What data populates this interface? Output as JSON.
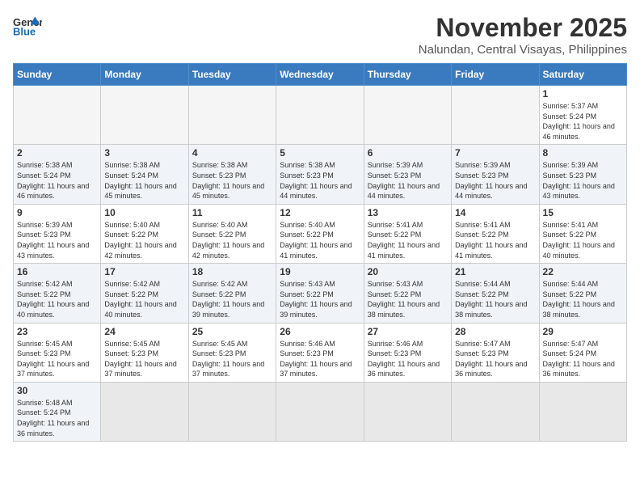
{
  "header": {
    "logo_general": "General",
    "logo_blue": "Blue",
    "month_title": "November 2025",
    "location": "Nalundan, Central Visayas, Philippines"
  },
  "days_of_week": [
    "Sunday",
    "Monday",
    "Tuesday",
    "Wednesday",
    "Thursday",
    "Friday",
    "Saturday"
  ],
  "weeks": [
    {
      "alt": false,
      "days": [
        {
          "number": "",
          "empty": true
        },
        {
          "number": "",
          "empty": true
        },
        {
          "number": "",
          "empty": true
        },
        {
          "number": "",
          "empty": true
        },
        {
          "number": "",
          "empty": true
        },
        {
          "number": "",
          "empty": true
        },
        {
          "number": "1",
          "sunrise": "5:37 AM",
          "sunset": "5:24 PM",
          "daylight": "11 hours and 46 minutes."
        }
      ]
    },
    {
      "alt": true,
      "days": [
        {
          "number": "2",
          "sunrise": "5:38 AM",
          "sunset": "5:24 PM",
          "daylight": "11 hours and 46 minutes."
        },
        {
          "number": "3",
          "sunrise": "5:38 AM",
          "sunset": "5:24 PM",
          "daylight": "11 hours and 45 minutes."
        },
        {
          "number": "4",
          "sunrise": "5:38 AM",
          "sunset": "5:23 PM",
          "daylight": "11 hours and 45 minutes."
        },
        {
          "number": "5",
          "sunrise": "5:38 AM",
          "sunset": "5:23 PM",
          "daylight": "11 hours and 44 minutes."
        },
        {
          "number": "6",
          "sunrise": "5:39 AM",
          "sunset": "5:23 PM",
          "daylight": "11 hours and 44 minutes."
        },
        {
          "number": "7",
          "sunrise": "5:39 AM",
          "sunset": "5:23 PM",
          "daylight": "11 hours and 44 minutes."
        },
        {
          "number": "8",
          "sunrise": "5:39 AM",
          "sunset": "5:23 PM",
          "daylight": "11 hours and 43 minutes."
        }
      ]
    },
    {
      "alt": false,
      "days": [
        {
          "number": "9",
          "sunrise": "5:39 AM",
          "sunset": "5:23 PM",
          "daylight": "11 hours and 43 minutes."
        },
        {
          "number": "10",
          "sunrise": "5:40 AM",
          "sunset": "5:22 PM",
          "daylight": "11 hours and 42 minutes."
        },
        {
          "number": "11",
          "sunrise": "5:40 AM",
          "sunset": "5:22 PM",
          "daylight": "11 hours and 42 minutes."
        },
        {
          "number": "12",
          "sunrise": "5:40 AM",
          "sunset": "5:22 PM",
          "daylight": "11 hours and 41 minutes."
        },
        {
          "number": "13",
          "sunrise": "5:41 AM",
          "sunset": "5:22 PM",
          "daylight": "11 hours and 41 minutes."
        },
        {
          "number": "14",
          "sunrise": "5:41 AM",
          "sunset": "5:22 PM",
          "daylight": "11 hours and 41 minutes."
        },
        {
          "number": "15",
          "sunrise": "5:41 AM",
          "sunset": "5:22 PM",
          "daylight": "11 hours and 40 minutes."
        }
      ]
    },
    {
      "alt": true,
      "days": [
        {
          "number": "16",
          "sunrise": "5:42 AM",
          "sunset": "5:22 PM",
          "daylight": "11 hours and 40 minutes."
        },
        {
          "number": "17",
          "sunrise": "5:42 AM",
          "sunset": "5:22 PM",
          "daylight": "11 hours and 40 minutes."
        },
        {
          "number": "18",
          "sunrise": "5:42 AM",
          "sunset": "5:22 PM",
          "daylight": "11 hours and 39 minutes."
        },
        {
          "number": "19",
          "sunrise": "5:43 AM",
          "sunset": "5:22 PM",
          "daylight": "11 hours and 39 minutes."
        },
        {
          "number": "20",
          "sunrise": "5:43 AM",
          "sunset": "5:22 PM",
          "daylight": "11 hours and 38 minutes."
        },
        {
          "number": "21",
          "sunrise": "5:44 AM",
          "sunset": "5:22 PM",
          "daylight": "11 hours and 38 minutes."
        },
        {
          "number": "22",
          "sunrise": "5:44 AM",
          "sunset": "5:22 PM",
          "daylight": "11 hours and 38 minutes."
        }
      ]
    },
    {
      "alt": false,
      "days": [
        {
          "number": "23",
          "sunrise": "5:45 AM",
          "sunset": "5:23 PM",
          "daylight": "11 hours and 37 minutes."
        },
        {
          "number": "24",
          "sunrise": "5:45 AM",
          "sunset": "5:23 PM",
          "daylight": "11 hours and 37 minutes."
        },
        {
          "number": "25",
          "sunrise": "5:45 AM",
          "sunset": "5:23 PM",
          "daylight": "11 hours and 37 minutes."
        },
        {
          "number": "26",
          "sunrise": "5:46 AM",
          "sunset": "5:23 PM",
          "daylight": "11 hours and 37 minutes."
        },
        {
          "number": "27",
          "sunrise": "5:46 AM",
          "sunset": "5:23 PM",
          "daylight": "11 hours and 36 minutes."
        },
        {
          "number": "28",
          "sunrise": "5:47 AM",
          "sunset": "5:23 PM",
          "daylight": "11 hours and 36 minutes."
        },
        {
          "number": "29",
          "sunrise": "5:47 AM",
          "sunset": "5:24 PM",
          "daylight": "11 hours and 36 minutes."
        }
      ]
    },
    {
      "alt": true,
      "days": [
        {
          "number": "30",
          "sunrise": "5:48 AM",
          "sunset": "5:24 PM",
          "daylight": "11 hours and 36 minutes."
        },
        {
          "number": "",
          "empty": true
        },
        {
          "number": "",
          "empty": true
        },
        {
          "number": "",
          "empty": true
        },
        {
          "number": "",
          "empty": true
        },
        {
          "number": "",
          "empty": true
        },
        {
          "number": "",
          "empty": true
        }
      ]
    }
  ],
  "labels": {
    "sunrise": "Sunrise:",
    "sunset": "Sunset:",
    "daylight": "Daylight:"
  }
}
